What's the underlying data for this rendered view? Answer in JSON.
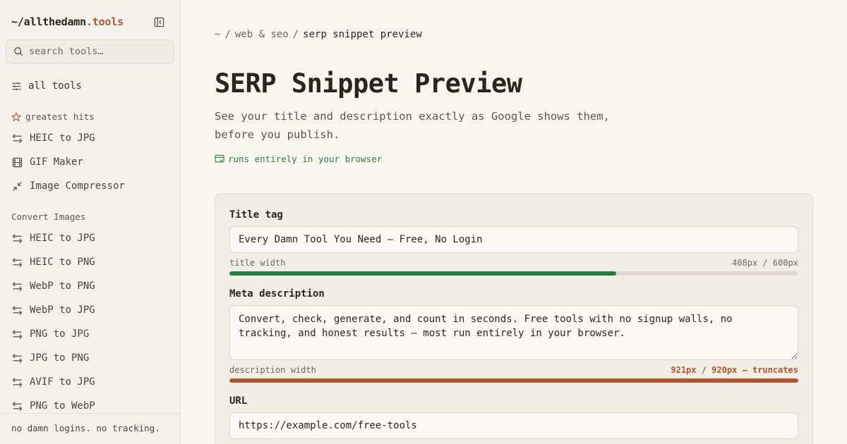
{
  "sidebar": {
    "logo_prefix": "~/allthedamn",
    "logo_suffix": ".tools",
    "search_placeholder": "search tools…",
    "all_tools_label": "all tools",
    "greatest_hits_label": "greatest hits",
    "greatest_hits": [
      {
        "label": "HEIC to JPG",
        "icon": "arrows-exchange-icon"
      },
      {
        "label": "GIF Maker",
        "icon": "film-icon"
      },
      {
        "label": "Image Compressor",
        "icon": "compress-arrows-icon"
      }
    ],
    "convert_images_label": "Convert Images",
    "convert_images": [
      {
        "label": "HEIC to JPG",
        "icon": "arrows-exchange-icon"
      },
      {
        "label": "HEIC to PNG",
        "icon": "arrows-exchange-icon"
      },
      {
        "label": "WebP to PNG",
        "icon": "arrows-exchange-icon"
      },
      {
        "label": "WebP to JPG",
        "icon": "arrows-exchange-icon"
      },
      {
        "label": "PNG to JPG",
        "icon": "arrows-exchange-icon"
      },
      {
        "label": "JPG to PNG",
        "icon": "arrows-exchange-icon"
      },
      {
        "label": "AVIF to JPG",
        "icon": "arrows-exchange-icon"
      },
      {
        "label": "PNG to WebP",
        "icon": "arrows-exchange-icon"
      }
    ],
    "footer": "no damn logins. no tracking."
  },
  "breadcrumb": {
    "root": "~",
    "category": "web & seo",
    "current": "serp snippet preview"
  },
  "page": {
    "title": "SERP Snippet Preview",
    "subtitle": "See your title and description exactly as Google shows them, before you publish.",
    "local_badge": "runs entirely in your browser"
  },
  "form": {
    "title_label": "Title tag",
    "title_value": "Every Damn Tool You Need — Free, No Login",
    "title_width_label": "title width",
    "title_width_value": "408px / 600px",
    "title_width_fraction": 0.68,
    "description_label": "Meta description",
    "description_value": "Convert, check, generate, and count in seconds. Free tools with no signup walls, no tracking, and honest results — most run entirely in your browser.",
    "description_width_label": "description width",
    "description_width_value": "921px / 920px — truncates",
    "description_width_fraction": 1.0,
    "url_label": "URL",
    "url_value": "https://example.com/free-tools"
  },
  "colors": {
    "accent": "#b5532f",
    "ok": "#2f7a45",
    "background": "#f8f6f1"
  }
}
